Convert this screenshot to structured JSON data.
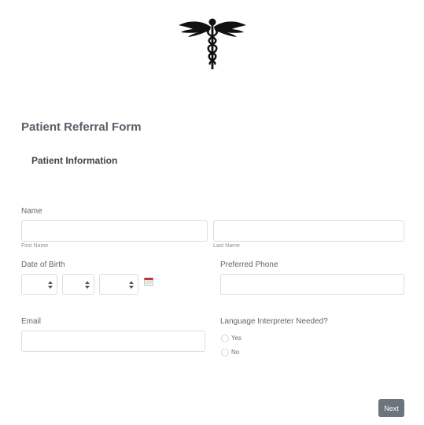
{
  "form": {
    "title": "Patient Referral Form",
    "section_title": "Patient Information",
    "logo_icon": "caduceus-icon"
  },
  "fields": {
    "name": {
      "label": "Name",
      "first_sublabel": "First Name",
      "last_sublabel": "Last Name",
      "first_value": "",
      "last_value": ""
    },
    "dob": {
      "label": "Date of Birth",
      "month_value": "",
      "day_value": "",
      "year_value": "",
      "calendar_icon": "calendar-icon"
    },
    "phone": {
      "label": "Preferred Phone",
      "value": ""
    },
    "email": {
      "label": "Email",
      "value": ""
    },
    "interpreter": {
      "label": "Language Interpreter Needed?",
      "options": [
        "Yes",
        "No"
      ]
    }
  },
  "actions": {
    "next_label": "Next"
  },
  "colors": {
    "button_bg": "#6c747c",
    "border": "#d9dde2",
    "calendar_accent": "#c0392b"
  }
}
